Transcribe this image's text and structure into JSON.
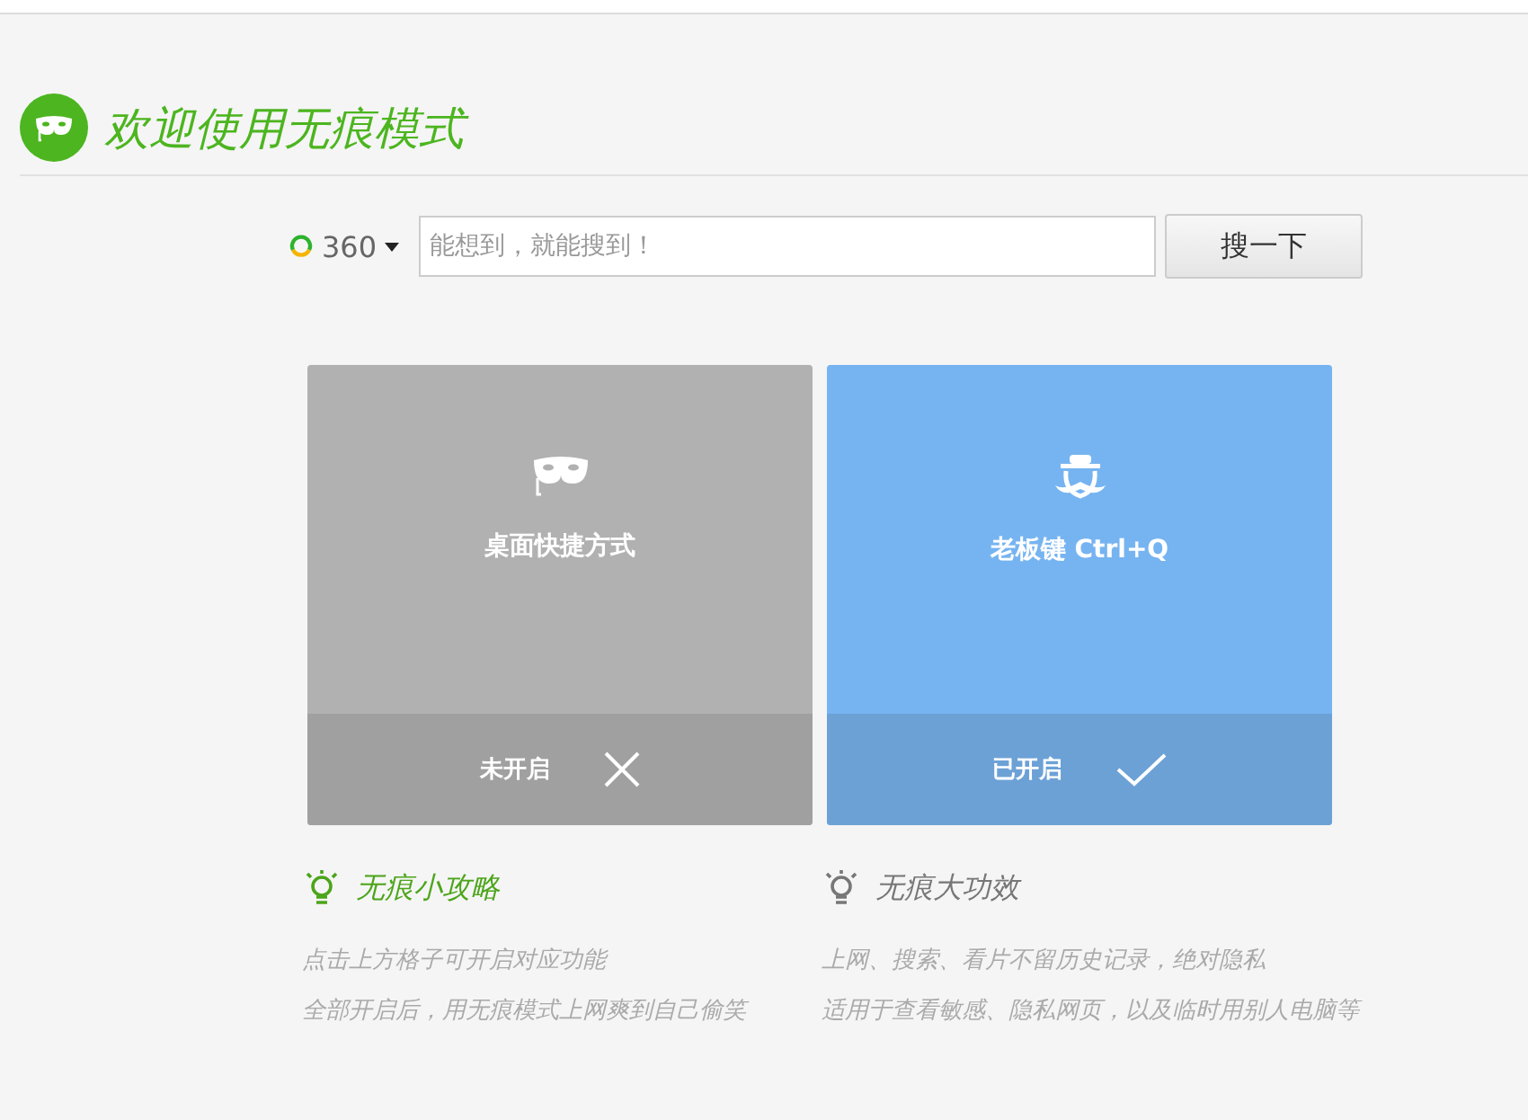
{
  "header": {
    "title": "欢迎使用无痕模式"
  },
  "search": {
    "engine": "360",
    "placeholder": "能想到，就能搜到！",
    "button": "搜一下"
  },
  "tiles": [
    {
      "kind": "mask",
      "label": "桌面快捷方式",
      "on": false,
      "status": "未开启"
    },
    {
      "kind": "boss",
      "label": "老板键 Ctrl+Q",
      "on": true,
      "status": "已开启"
    }
  ],
  "tips": [
    {
      "title": "无痕小攻略",
      "color": "#4ca51a",
      "lines": [
        "点击上方格子可开启对应功能",
        "全部开启后，用无痕模式上网爽到自己偷笑"
      ]
    },
    {
      "title": "无痕大功效",
      "color": "#777777",
      "lines": [
        "上网、搜索、看片不留历史记录，绝对隐私",
        "适用于查看敏感、隐私网页，以及临时用别人电脑等"
      ]
    }
  ]
}
